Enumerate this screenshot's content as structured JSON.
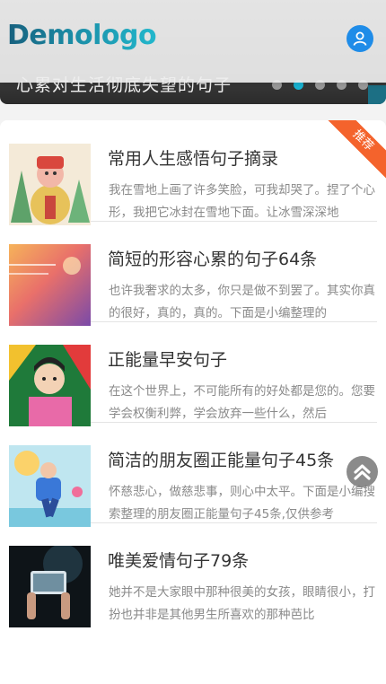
{
  "header": {
    "logo_text": "Demologo",
    "user_icon": "user-icon",
    "brand_colors": [
      "#17607e",
      "#23b7cc"
    ]
  },
  "hero": {
    "caption": "心累对生活彻底失望的句子",
    "slide_count": 5,
    "active_slide": 2,
    "active_dot_color": "#19b4d3"
  },
  "list": {
    "badge": "推荐",
    "badge_color": "#f4632c",
    "items": [
      {
        "title": "常用人生感悟句子摘录",
        "desc": "我在雪地上画了许多笑脸，可我却哭了。捏了个心形，我把它冰封在雪地下面。让冰雪深深地",
        "thumb": "toy-figure-image"
      },
      {
        "title": "简短的形容心累的句子64条",
        "desc": "也许我奢求的太多，你只是做不到罢了。其实你真的很好，真的，真的。下面是小编整理的",
        "thumb": "gradient-poster-image"
      },
      {
        "title": "正能量早安句子",
        "desc": "在这个世界上，不可能所有的好处都是您的。您要学会权衡利弊，学会放弃一些什么，然后",
        "thumb": "pop-art-portrait-image"
      },
      {
        "title": "简洁的朋友圈正能量句子45条",
        "desc": "怀慈悲心，做慈悲事，则心中太平。下面是小编搜索整理的朋友圈正能量句子45条,仅供参考",
        "thumb": "illustrated-runner-image"
      },
      {
        "title": "唯美爱情句子79条",
        "desc": "她并不是大家眼中那种很美的女孩，眼睛很小，打扮也并非是其他男生所喜欢的那种芭比",
        "thumb": "concert-phone-image"
      }
    ]
  },
  "scroll_top_icon": "chevron-double-up-icon"
}
